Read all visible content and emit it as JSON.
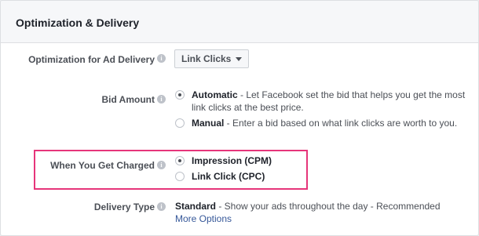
{
  "section": {
    "title": "Optimization & Delivery"
  },
  "optimization": {
    "label": "Optimization for Ad Delivery",
    "value": "Link Clicks"
  },
  "bid_amount": {
    "label": "Bid Amount",
    "options": [
      {
        "name": "Automatic",
        "description": " - Let Facebook set the bid that helps you get the most link clicks at the best price.",
        "selected": true
      },
      {
        "name": "Manual",
        "description": " - Enter a bid based on what link clicks are worth to you.",
        "selected": false
      }
    ]
  },
  "charged": {
    "label": "When You Get Charged",
    "options": [
      {
        "name": "Impression (CPM)",
        "selected": true
      },
      {
        "name": "Link Click (CPC)",
        "selected": false
      }
    ]
  },
  "delivery_type": {
    "label": "Delivery Type",
    "value": "Standard",
    "description": " - Show your ads throughout the day - Recommended",
    "more_link": "More Options"
  },
  "info_icon_glyph": "i",
  "highlight_color": "#e6357a"
}
